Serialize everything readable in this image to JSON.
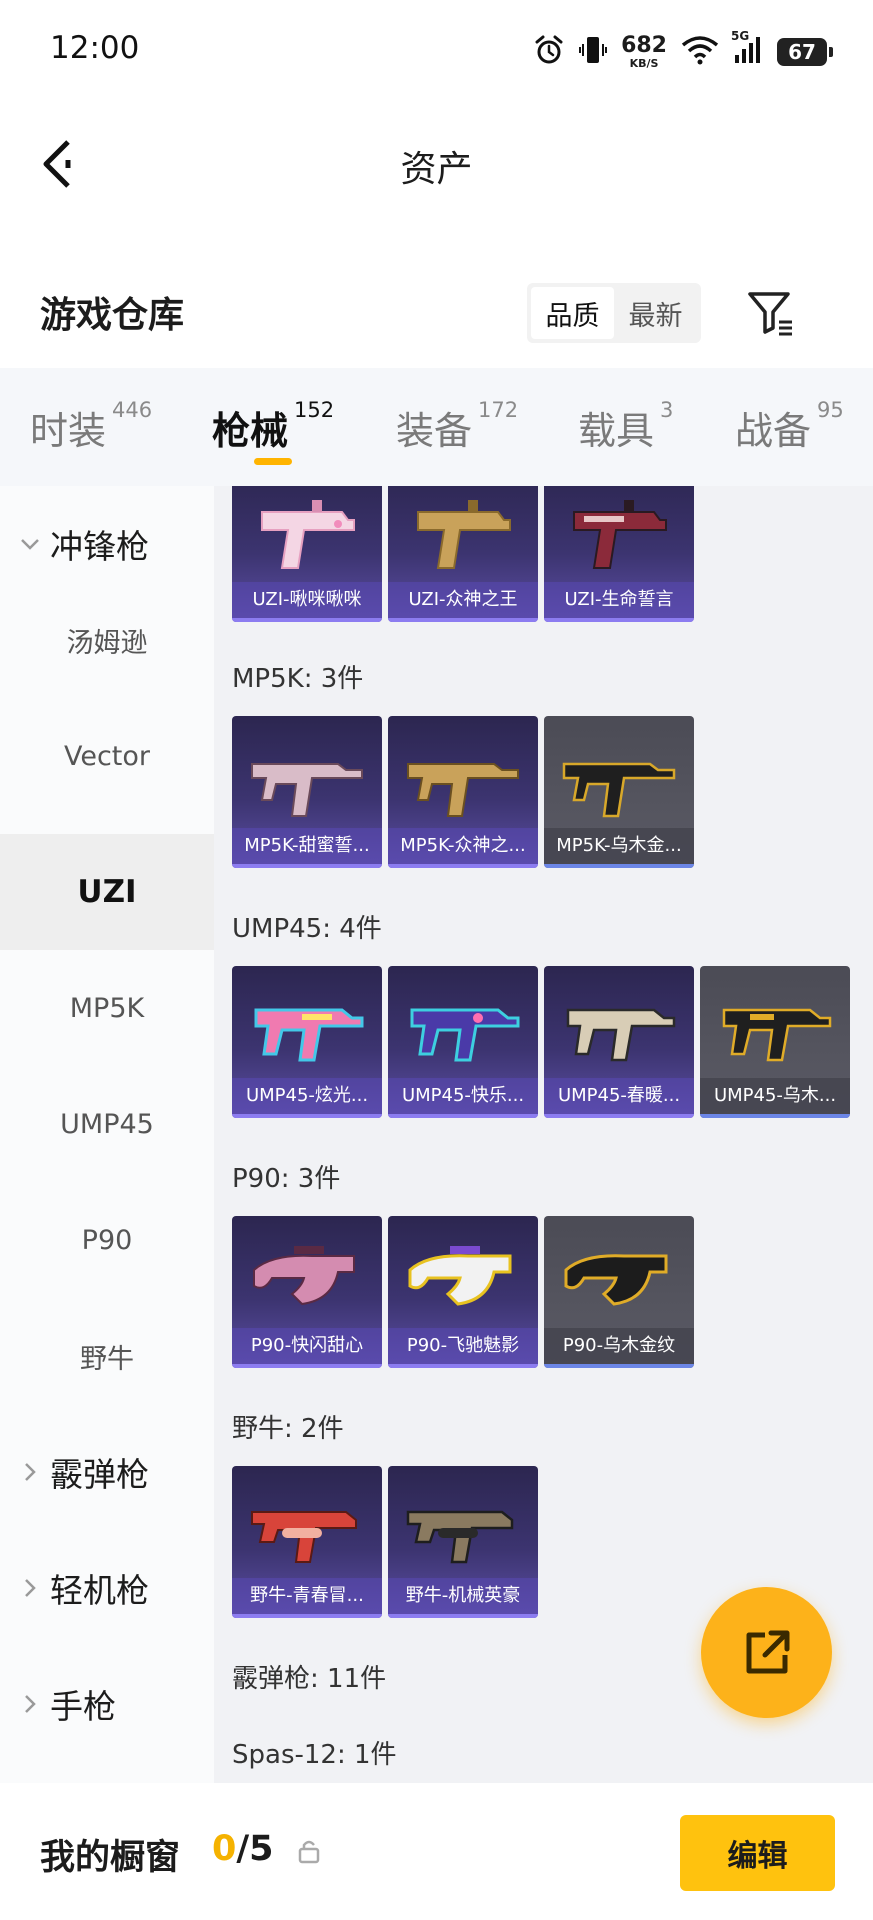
{
  "status_bar": {
    "time": "12:00",
    "net_speed": "682",
    "net_unit": "KB/S",
    "network": "5G",
    "battery": "67",
    "icons": [
      "alarm-icon",
      "vibrate-icon",
      "wifi-icon",
      "signal-icon",
      "battery-icon"
    ]
  },
  "header": {
    "title": "资产",
    "back_icon": "chevron-left-icon"
  },
  "warehouse": {
    "title": "游戏仓库",
    "sort_options": [
      "品质",
      "最新"
    ],
    "sort_selected": "品质",
    "filter_icon": "filter-icon"
  },
  "tabs": [
    {
      "label": "时装",
      "count": "446",
      "active": false
    },
    {
      "label": "枪械",
      "count": "152",
      "active": true
    },
    {
      "label": "装备",
      "count": "172",
      "active": false
    },
    {
      "label": "载具",
      "count": "3",
      "active": false
    },
    {
      "label": "战备",
      "count": "95",
      "active": false
    }
  ],
  "sidebar": {
    "items": [
      {
        "label": "冲锋枪",
        "type": "group",
        "expanded": true
      },
      {
        "label": "汤姆逊",
        "type": "sub"
      },
      {
        "label": "Vector",
        "type": "sub"
      },
      {
        "label": "UZI",
        "type": "sub",
        "active": true
      },
      {
        "label": "MP5K",
        "type": "sub"
      },
      {
        "label": "UMP45",
        "type": "sub"
      },
      {
        "label": "P90",
        "type": "sub"
      },
      {
        "label": "野牛",
        "type": "sub"
      },
      {
        "label": "霰弹枪",
        "type": "group",
        "expanded": false
      },
      {
        "label": "轻机枪",
        "type": "group",
        "expanded": false
      },
      {
        "label": "手枪",
        "type": "group",
        "expanded": false
      }
    ]
  },
  "content": {
    "uzi_items": [
      {
        "name": "UZI-啾咪啾咪",
        "tone": "purple"
      },
      {
        "name": "UZI-众神之王",
        "tone": "purple"
      },
      {
        "name": "UZI-生命誓言",
        "tone": "purple"
      }
    ],
    "sections": [
      {
        "title": "MP5K: 3件",
        "items": [
          {
            "name": "MP5K-甜蜜誓...",
            "tone": "purple"
          },
          {
            "name": "MP5K-众神之...",
            "tone": "purple"
          },
          {
            "name": "MP5K-乌木金...",
            "tone": "gray"
          }
        ]
      },
      {
        "title": "UMP45: 4件",
        "items": [
          {
            "name": "UMP45-炫光...",
            "tone": "purple"
          },
          {
            "name": "UMP45-快乐...",
            "tone": "purple"
          },
          {
            "name": "UMP45-春暖...",
            "tone": "purple"
          },
          {
            "name": "UMP45-乌木...",
            "tone": "gray"
          }
        ]
      },
      {
        "title": "P90: 3件",
        "items": [
          {
            "name": "P90-快闪甜心",
            "tone": "purple"
          },
          {
            "name": "P90-飞驰魅影",
            "tone": "purple"
          },
          {
            "name": "P90-乌木金纹",
            "tone": "gray"
          }
        ]
      },
      {
        "title": "野牛: 2件",
        "items": [
          {
            "name": "野牛-青春冒...",
            "tone": "purple"
          },
          {
            "name": "野牛-机械英豪",
            "tone": "purple"
          }
        ]
      }
    ],
    "shotgun_header": "霰弹枪: 11件",
    "spas_header": "Spas-12: 1件"
  },
  "fab": {
    "icon": "share-external-icon"
  },
  "bottom_bar": {
    "title": "我的橱窗",
    "count_current": "0",
    "count_total": "/5",
    "lock_icon": "lock-icon",
    "edit_label": "编辑"
  },
  "colors": {
    "accent": "#ffc20e",
    "tab_indicator": "#ffb400",
    "card_purple": "#3c3470",
    "card_gray": "#55555f"
  }
}
